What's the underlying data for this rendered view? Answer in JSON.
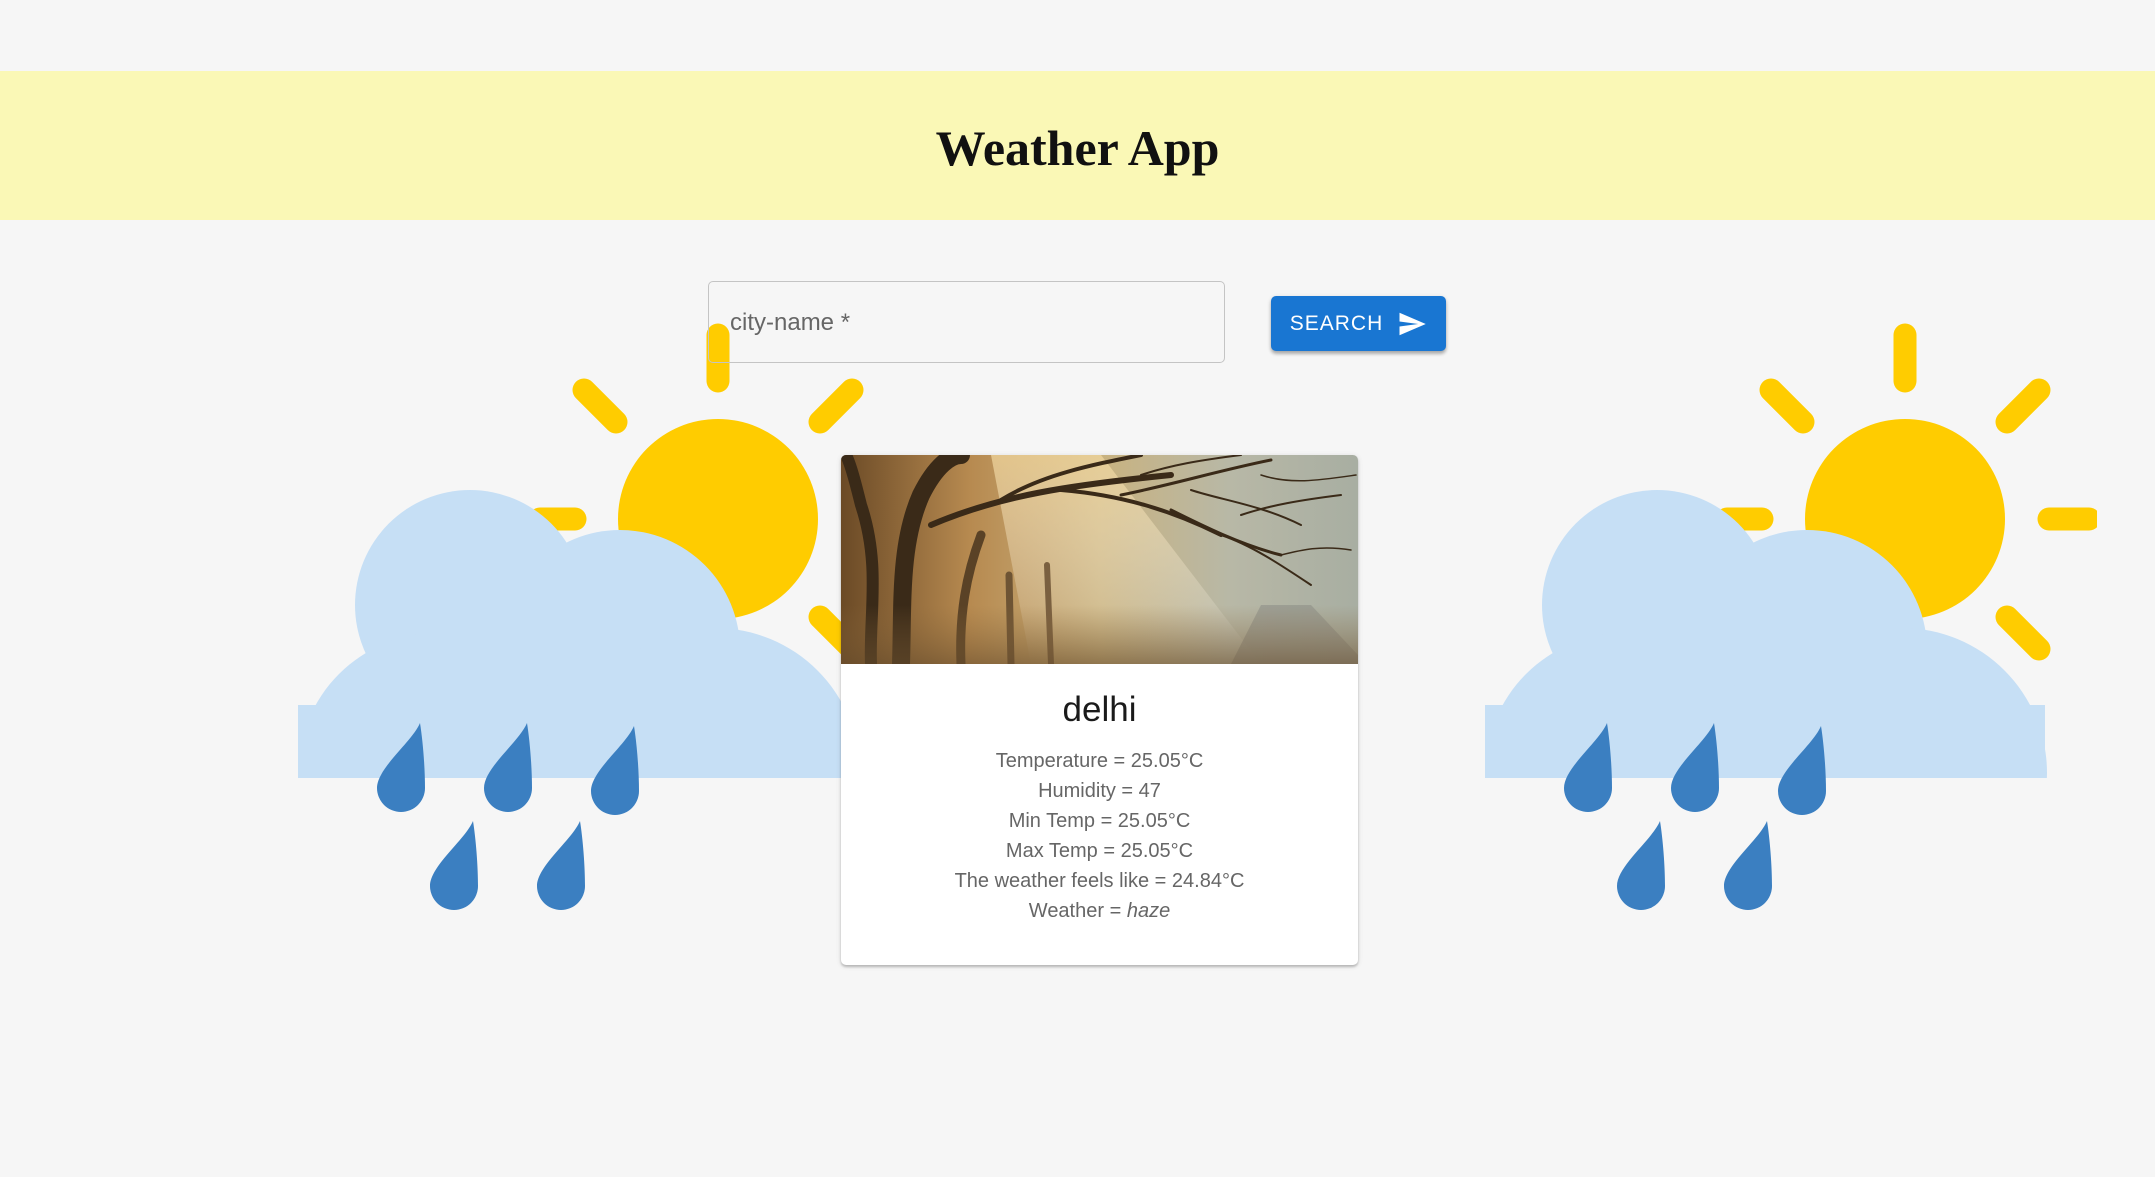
{
  "header": {
    "title": "Weather App"
  },
  "search": {
    "label": "city-name *",
    "value": "",
    "button_label": "SEARCH"
  },
  "card": {
    "city": "delhi",
    "temperature": "Temperature = 25.05°C",
    "humidity": "Humidity = 47",
    "min_temp": "Min Temp = 25.05°C",
    "max_temp": "Max Temp = 25.05°C",
    "feels_like": "The weather feels like = 24.84°C",
    "weather_label": "Weather = ",
    "weather_value": "haze"
  },
  "colors": {
    "header_bg": "#faf8b6",
    "accent": "#1976d2",
    "sun": "#ffcc00",
    "cloud": "#c6dff5",
    "rain": "#3b7fc1"
  },
  "icons": {
    "left_illustration": "sun-cloud-rain-icon",
    "right_illustration": "sun-cloud-rain-icon",
    "button_icon": "send-icon"
  }
}
